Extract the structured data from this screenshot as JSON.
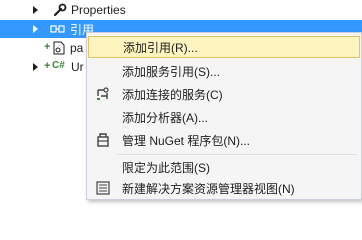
{
  "tree": {
    "properties": {
      "label": "Properties"
    },
    "references": {
      "label": "引用"
    },
    "package_item": {
      "label": "pa"
    },
    "unit_item": {
      "label": "Ur"
    }
  },
  "context_menu": {
    "items": [
      {
        "label": "添加引用(R)...",
        "icon": "none"
      },
      {
        "label": "添加服务引用(S)...",
        "icon": "none"
      },
      {
        "label": "添加连接的服务(C)",
        "icon": "connected-service-icon"
      },
      {
        "label": "添加分析器(A)...",
        "icon": "none"
      },
      {
        "label": "管理 NuGet 程序包(N)...",
        "icon": "nuget-icon"
      },
      {
        "label": "限定为此范围(S)",
        "icon": "none"
      },
      {
        "label": "新建解决方案资源管理器视图(N)",
        "icon": "new-view-icon"
      }
    ]
  },
  "colors": {
    "selection": "#3399ff",
    "menu_hover": "#fdf4bf",
    "menu_background": "#f5f5f5"
  }
}
